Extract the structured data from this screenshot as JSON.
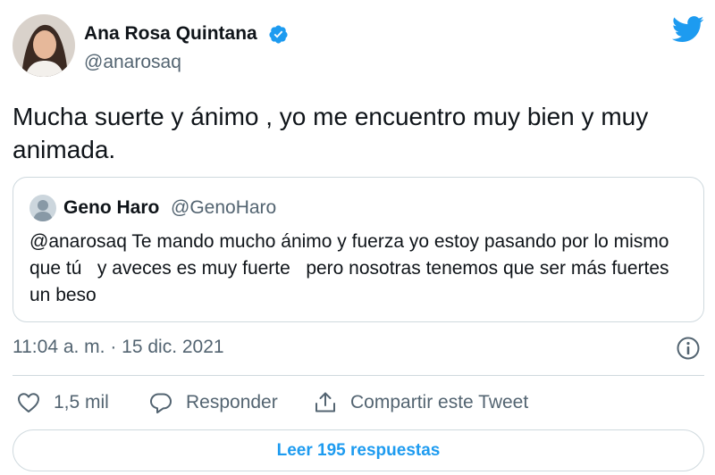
{
  "author": {
    "name": "Ana Rosa Quintana",
    "handle": "@anarosaq",
    "verified": true
  },
  "tweet": {
    "text": "Mucha suerte y ánimo , yo me encuentro muy bien y muy animada."
  },
  "quoted_tweet": {
    "name": "Geno Haro",
    "handle": "@GenoHaro",
    "text": "@anarosaq Te mando mucho ánimo y fuerza yo estoy pasando por lo mismo que tú   y aveces es muy fuerte   pero nosotras tenemos que ser más fuertes un beso"
  },
  "meta": {
    "timestamp": "11:04 a. m. · 15 dic. 2021"
  },
  "actions": {
    "likes": "1,5 mil",
    "reply_label": "Responder",
    "share_label": "Compartir este Tweet"
  },
  "read_replies_label": "Leer 195 respuestas",
  "colors": {
    "brand_blue": "#1d9bf0",
    "text_primary": "#0f1419",
    "text_secondary": "#536471",
    "border": "#cfd9de"
  },
  "icons": [
    "verified-badge-icon",
    "twitter-bird-icon",
    "info-icon",
    "heart-icon",
    "reply-bubble-icon",
    "share-icon"
  ]
}
